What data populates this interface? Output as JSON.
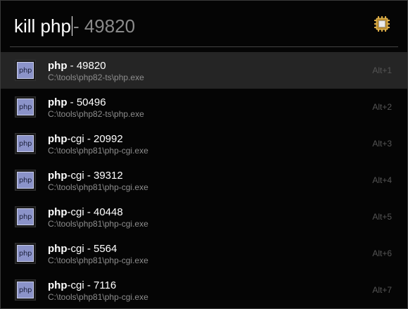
{
  "query": {
    "typed": "kill php",
    "hint": " - 49820"
  },
  "plugin_icon": "processor-chip-icon",
  "results": [
    {
      "highlight": "php",
      "rest": " - 49820",
      "path": "C:\\tools\\php82-ts\\php.exe",
      "hotkey": "Alt+1",
      "icon": "php-icon",
      "icon_text": "php",
      "selected": true
    },
    {
      "highlight": "php",
      "rest": " - 50496",
      "path": "C:\\tools\\php82-ts\\php.exe",
      "hotkey": "Alt+2",
      "icon": "php-icon",
      "icon_text": "php",
      "selected": false
    },
    {
      "highlight": "php",
      "rest": "-cgi - 20992",
      "path": "C:\\tools\\php81\\php-cgi.exe",
      "hotkey": "Alt+3",
      "icon": "php-icon",
      "icon_text": "php",
      "selected": false
    },
    {
      "highlight": "php",
      "rest": "-cgi - 39312",
      "path": "C:\\tools\\php81\\php-cgi.exe",
      "hotkey": "Alt+4",
      "icon": "php-icon",
      "icon_text": "php",
      "selected": false
    },
    {
      "highlight": "php",
      "rest": "-cgi - 40448",
      "path": "C:\\tools\\php81\\php-cgi.exe",
      "hotkey": "Alt+5",
      "icon": "php-icon",
      "icon_text": "php",
      "selected": false
    },
    {
      "highlight": "php",
      "rest": "-cgi - 5564",
      "path": "C:\\tools\\php81\\php-cgi.exe",
      "hotkey": "Alt+6",
      "icon": "php-icon",
      "icon_text": "php",
      "selected": false
    },
    {
      "highlight": "php",
      "rest": "-cgi - 7116",
      "path": "C:\\tools\\php81\\php-cgi.exe",
      "hotkey": "Alt+7",
      "icon": "php-icon",
      "icon_text": "php",
      "selected": false
    }
  ],
  "colors": {
    "background": "#050505",
    "selected_row": "#252525",
    "hint_text": "#8a8a8a",
    "path_text": "#8d8d8d",
    "hotkey_text": "#555555",
    "php_badge": "#8b93c9",
    "chip_gold": "#d8a640"
  }
}
